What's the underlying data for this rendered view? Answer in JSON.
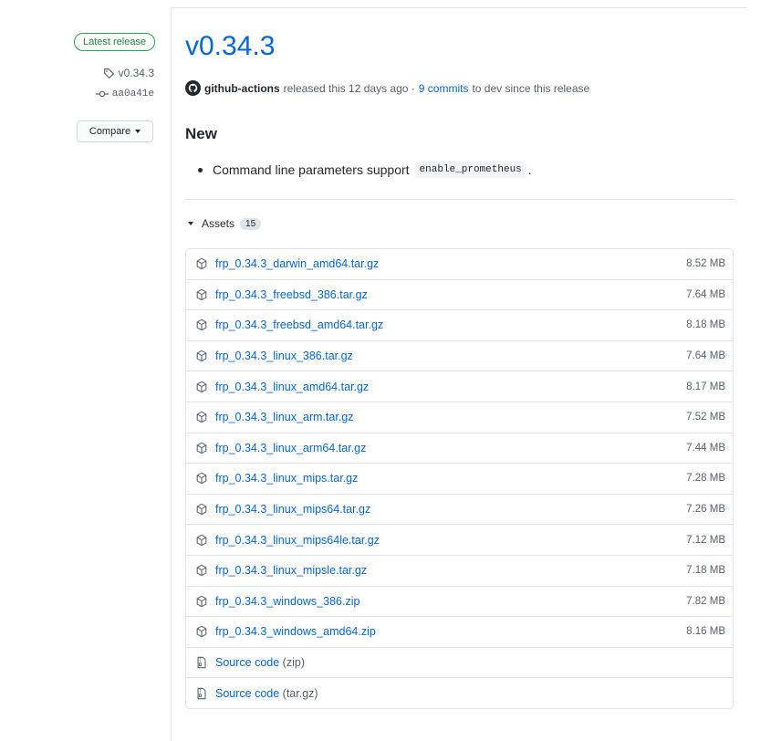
{
  "sidebar": {
    "latest_label": "Latest release",
    "tag": "v0.34.3",
    "commit": "aa0a41e",
    "compare_label": "Compare"
  },
  "release": {
    "title": "v0.34.3",
    "author": "github-actions",
    "released_text": "released this 12 days ago ·",
    "commits_link": "9 commits",
    "commits_suffix": "to dev since this release",
    "section_heading": "New",
    "note_text": "Command line parameters support",
    "note_code": "enable_prometheus",
    "note_end": "."
  },
  "assets": {
    "label": "Assets",
    "count": "15",
    "files": [
      {
        "name": "frp_0.34.3_darwin_amd64.tar.gz",
        "size": "8.52 MB"
      },
      {
        "name": "frp_0.34.3_freebsd_386.tar.gz",
        "size": "7.64 MB"
      },
      {
        "name": "frp_0.34.3_freebsd_amd64.tar.gz",
        "size": "8.18 MB"
      },
      {
        "name": "frp_0.34.3_linux_386.tar.gz",
        "size": "7.64 MB"
      },
      {
        "name": "frp_0.34.3_linux_amd64.tar.gz",
        "size": "8.17 MB"
      },
      {
        "name": "frp_0.34.3_linux_arm.tar.gz",
        "size": "7.52 MB"
      },
      {
        "name": "frp_0.34.3_linux_arm64.tar.gz",
        "size": "7.44 MB"
      },
      {
        "name": "frp_0.34.3_linux_mips.tar.gz",
        "size": "7.28 MB"
      },
      {
        "name": "frp_0.34.3_linux_mips64.tar.gz",
        "size": "7.26 MB"
      },
      {
        "name": "frp_0.34.3_linux_mips64le.tar.gz",
        "size": "7.12 MB"
      },
      {
        "name": "frp_0.34.3_linux_mipsle.tar.gz",
        "size": "7.18 MB"
      },
      {
        "name": "frp_0.34.3_windows_386.zip",
        "size": "7.82 MB"
      },
      {
        "name": "frp_0.34.3_windows_amd64.zip",
        "size": "8.16 MB"
      }
    ],
    "source": [
      {
        "label": "Source code",
        "suffix": "(zip)"
      },
      {
        "label": "Source code",
        "suffix": "(tar.gz)"
      }
    ]
  },
  "icons": {
    "package": "package-icon",
    "archive": "file-zip-icon",
    "tag": "tag-icon",
    "commit": "git-commit-icon",
    "avatar": "github-avatar-icon"
  },
  "colors": {
    "link": "#0366d6",
    "badge_green": "#28a745",
    "muted": "#586069",
    "border": "#e1e4e8"
  }
}
